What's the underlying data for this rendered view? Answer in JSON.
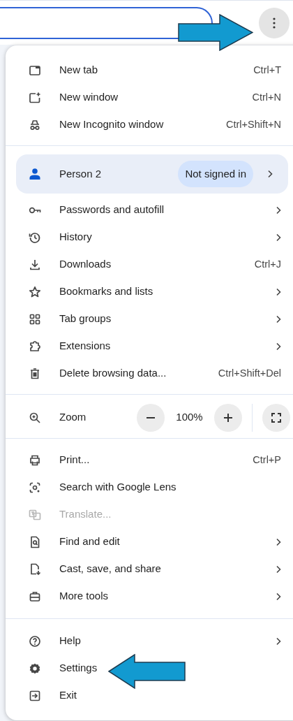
{
  "menu": {
    "sections": [
      {
        "items": [
          {
            "kind": "command",
            "label": "New tab",
            "shortcut": "Ctrl+T",
            "submenu": false,
            "disabled": false
          },
          {
            "kind": "command",
            "label": "New window",
            "shortcut": "Ctrl+N",
            "submenu": false,
            "disabled": false
          },
          {
            "kind": "command",
            "label": "New Incognito window",
            "shortcut": "Ctrl+Shift+N",
            "submenu": false,
            "disabled": false
          }
        ]
      },
      {
        "items": [
          {
            "kind": "profile",
            "label": "Person 2",
            "status": "Not signed in",
            "submenu": true
          },
          {
            "kind": "command",
            "label": "Passwords and autofill",
            "submenu": true,
            "disabled": false
          },
          {
            "kind": "command",
            "label": "History",
            "submenu": true,
            "disabled": false
          },
          {
            "kind": "command",
            "label": "Downloads",
            "shortcut": "Ctrl+J",
            "submenu": false,
            "disabled": false
          },
          {
            "kind": "command",
            "label": "Bookmarks and lists",
            "submenu": true,
            "disabled": false
          },
          {
            "kind": "command",
            "label": "Tab groups",
            "submenu": true,
            "disabled": false
          },
          {
            "kind": "command",
            "label": "Extensions",
            "submenu": true,
            "disabled": false
          },
          {
            "kind": "command",
            "label": "Delete browsing data...",
            "shortcut": "Ctrl+Shift+Del",
            "submenu": false,
            "disabled": false
          }
        ]
      },
      {
        "items": [
          {
            "kind": "zoom",
            "label": "Zoom",
            "value": "100%"
          }
        ]
      },
      {
        "items": [
          {
            "kind": "command",
            "label": "Print...",
            "shortcut": "Ctrl+P",
            "submenu": false,
            "disabled": false
          },
          {
            "kind": "command",
            "label": "Search with Google Lens",
            "submenu": false,
            "disabled": false
          },
          {
            "kind": "command",
            "label": "Translate...",
            "submenu": false,
            "disabled": true
          },
          {
            "kind": "command",
            "label": "Find and edit",
            "submenu": true,
            "disabled": false
          },
          {
            "kind": "command",
            "label": "Cast, save, and share",
            "submenu": true,
            "disabled": false
          },
          {
            "kind": "command",
            "label": "More tools",
            "submenu": true,
            "disabled": false
          }
        ]
      },
      {
        "items": [
          {
            "kind": "command",
            "label": "Help",
            "submenu": true,
            "disabled": false
          },
          {
            "kind": "command",
            "label": "Settings",
            "submenu": false,
            "disabled": false
          },
          {
            "kind": "command",
            "label": "Exit",
            "submenu": false,
            "disabled": false
          }
        ]
      }
    ]
  }
}
